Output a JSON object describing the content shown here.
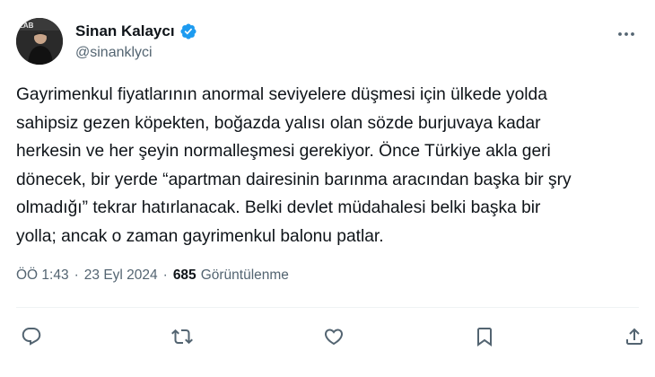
{
  "author": {
    "display_name": "Sinan Kalaycı",
    "handle": "@sinanklyci",
    "verified": true,
    "avatar_text": "LAB"
  },
  "tweet": {
    "text": "Gayrimenkul fiyatlarının anormal seviyelere düşmesi için ülkede yolda\nsahipsiz gezen köpekten, boğazda yalısı olan sözde burjuvaya kadar\nherkesin ve her şeyin normalleşmesi gerekiyor. Önce Türkiye akla geri\ndönecek, bir yerde “apartman dairesinin barınma aracından başka bir şry\nolmadığı” tekrar hatırlanacak. Belki devlet müdahalesi belki başka bir\nyolla; ancak o zaman gayrimenkul balonu patlar."
  },
  "meta": {
    "time": "ÖÖ 1:43",
    "date": "23 Eyl 2024",
    "separator": "·",
    "views_count": "685",
    "views_label": "Görüntülenme"
  },
  "icons": {
    "more": "more-horizontal-icon",
    "reply": "reply-icon",
    "retweet": "retweet-icon",
    "like": "heart-icon",
    "bookmark": "bookmark-icon",
    "share": "share-icon",
    "verified": "verified-badge-icon"
  },
  "colors": {
    "text": "#0f1419",
    "secondary": "#536471",
    "verified": "#1d9bf0",
    "divider": "#eff3f4"
  }
}
